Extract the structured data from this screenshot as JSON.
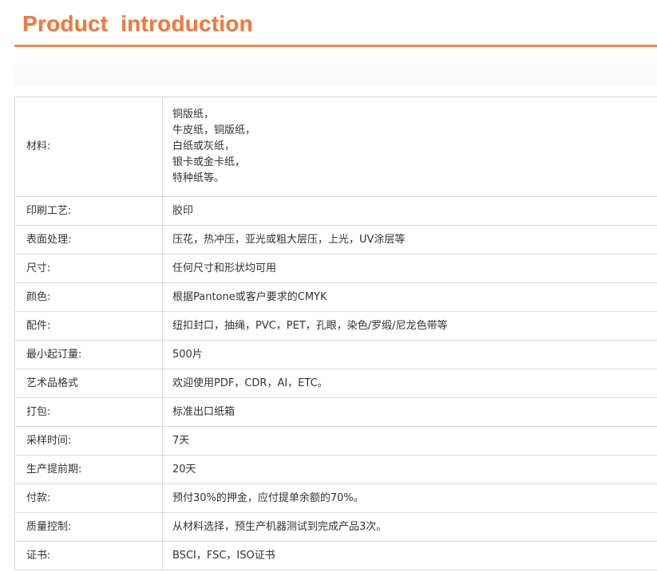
{
  "header": {
    "title": "Product  introduction"
  },
  "spec_table": {
    "material": {
      "label": "材料:",
      "lines": [
        "铜版纸，",
        "牛皮纸，铜版纸，",
        "白纸或灰纸，",
        "银卡或金卡纸，",
        "特种纸等。"
      ]
    },
    "rows": [
      {
        "label": "印刷工艺:",
        "value": "胶印"
      },
      {
        "label": "表面处理:",
        "value": "压花，热冲压，亚光或粗大层压，上光，UV涂层等"
      },
      {
        "label": "尺寸:",
        "value": "任何尺寸和形状均可用"
      },
      {
        "label": "颜色:",
        "value": "根据Pantone或客户要求的CMYK"
      },
      {
        "label": "配件:",
        "value": "纽扣封口，抽绳，PVC，PET，孔眼，染色/罗缎/尼龙色带等"
      },
      {
        "label": "最小起订量:",
        "value": "500片"
      },
      {
        "label": "艺术品格式",
        "value": "欢迎使用PDF，CDR，AI，ETC。"
      },
      {
        "label": "打包:",
        "value": "标准出口纸箱"
      },
      {
        "label": "采样时间:",
        "value": "7天"
      },
      {
        "label": "生产提前期:",
        "value": "20天"
      },
      {
        "label": "付款:",
        "value": "预付30%的押金，应付提单余额的70%。"
      },
      {
        "label": "质量控制:",
        "value": "从材料选择，预生产机器测试到完成产品3次。"
      },
      {
        "label": "证书:",
        "value": "BSCI，FSC，ISO证书"
      }
    ]
  },
  "colors": {
    "accent": "#ee7a3d",
    "rule": "#f08a4b",
    "border": "#d9d9d9",
    "text": "#333333"
  }
}
